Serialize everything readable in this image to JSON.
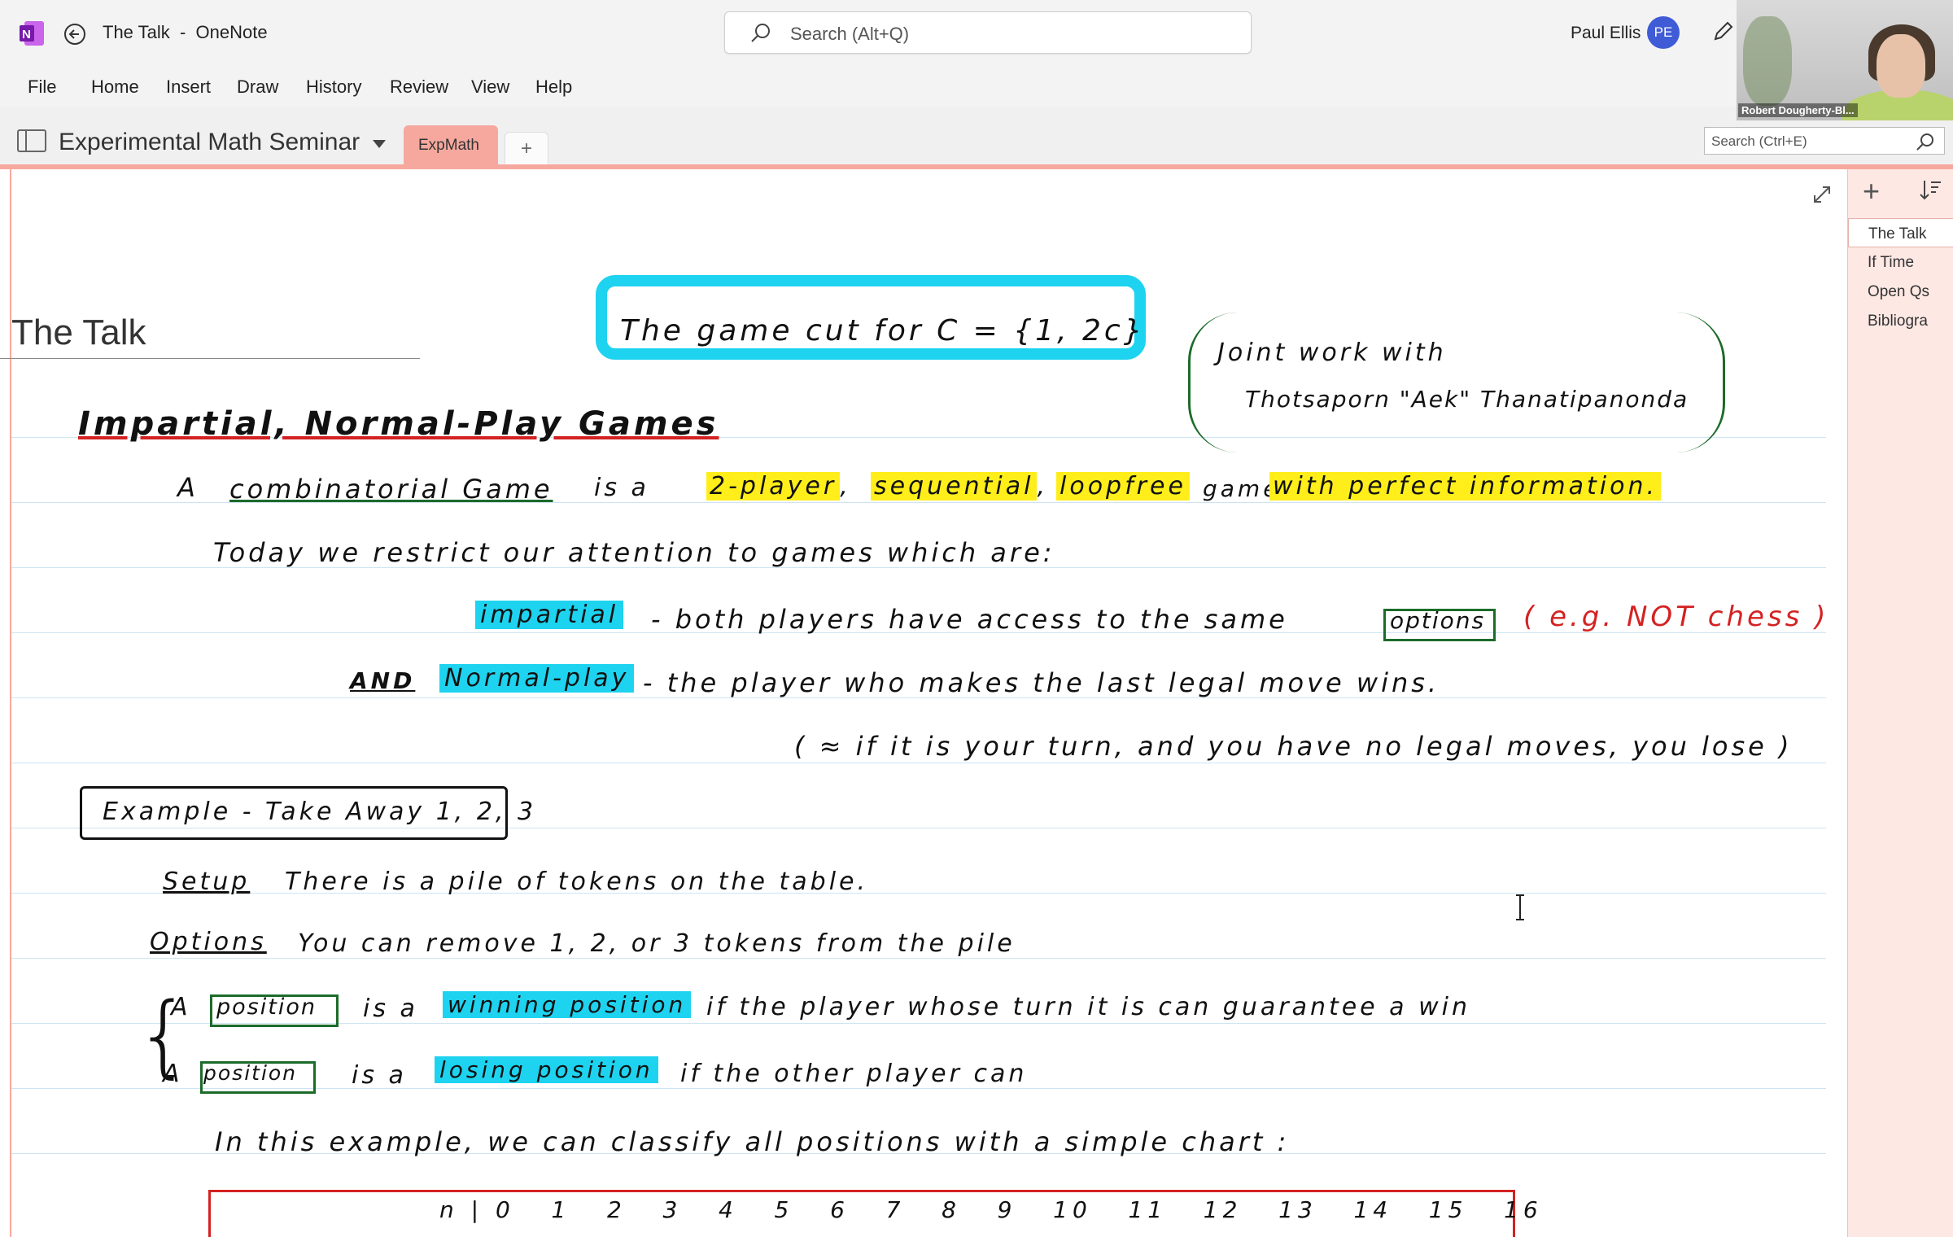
{
  "window": {
    "doc_title": "The Talk",
    "app_name": "OneNote",
    "search_placeholder": "Search (Alt+Q)",
    "user_name": "Paul Ellis",
    "user_initials": "PE"
  },
  "menu": [
    "File",
    "Home",
    "Insert",
    "Draw",
    "History",
    "Review",
    "View",
    "Help"
  ],
  "notebook": {
    "name": "Experimental Math Seminar",
    "section_tab": "ExpMath",
    "add_tab": "+",
    "page_search_placeholder": "Search (Ctrl+E)"
  },
  "webcam": {
    "participant_label": "Robert Dougherty-Bl..."
  },
  "page": {
    "title": "The Talk",
    "ink": {
      "headline": "The game cut for C = {1, 2c}",
      "joint_line1": "Joint work with",
      "joint_line2": "Thotsaporn \"Aek\" Thanatipanonda",
      "heading": "Impartial, Normal-Play Games",
      "def_a": "A",
      "def_comb": "combinatorial Game",
      "def_isa": "is a",
      "def_2player": "2-player",
      "def_seq": "sequential",
      "def_loopfree": "loopfree",
      "def_game": "game",
      "def_perfect": "with perfect information.",
      "today": "Today we restrict our attention to games which are:",
      "impartial": "impartial",
      "impartial_desc": "- both players have access to the same",
      "options_word": "options",
      "not_chess": "( e.g. NOT chess )",
      "and": "AND",
      "normal_play": "Normal-play",
      "normal_desc": "- the player who makes the last legal move wins.",
      "approx": "( ≈ if it is your turn, and you have no legal moves, you lose )",
      "example": "Example - Take Away 1, 2, 3",
      "setup_label": "Setup",
      "setup_text": "There is a pile of tokens on the table.",
      "options_label": "Options",
      "options_text": "You can remove 1, 2, or 3 tokens from the pile",
      "pos_a": "A",
      "position": "position",
      "is_a": "is a",
      "winning": "winning position",
      "winning_desc": "if the player whose turn it is can guarantee a win",
      "losing": "losing position",
      "losing_desc": "if the other player can",
      "classify": "In this example, we can classify all positions with a simple chart :",
      "chart_header": "n | 0   1   2   3   4   5   6   7   8   9   10   11   12   13   14   15   16"
    }
  },
  "pages": [
    "The Talk",
    "If Time",
    "Open Qs",
    "Bibliogra"
  ],
  "colors": {
    "accent_pink": "#f7a89e",
    "highlight_yellow": "#ffee1a",
    "highlight_cyan": "#1ed3ef",
    "ink_green": "#1c6b2a",
    "ink_red": "#d42222",
    "avatar_blue": "#3f5bd6"
  }
}
